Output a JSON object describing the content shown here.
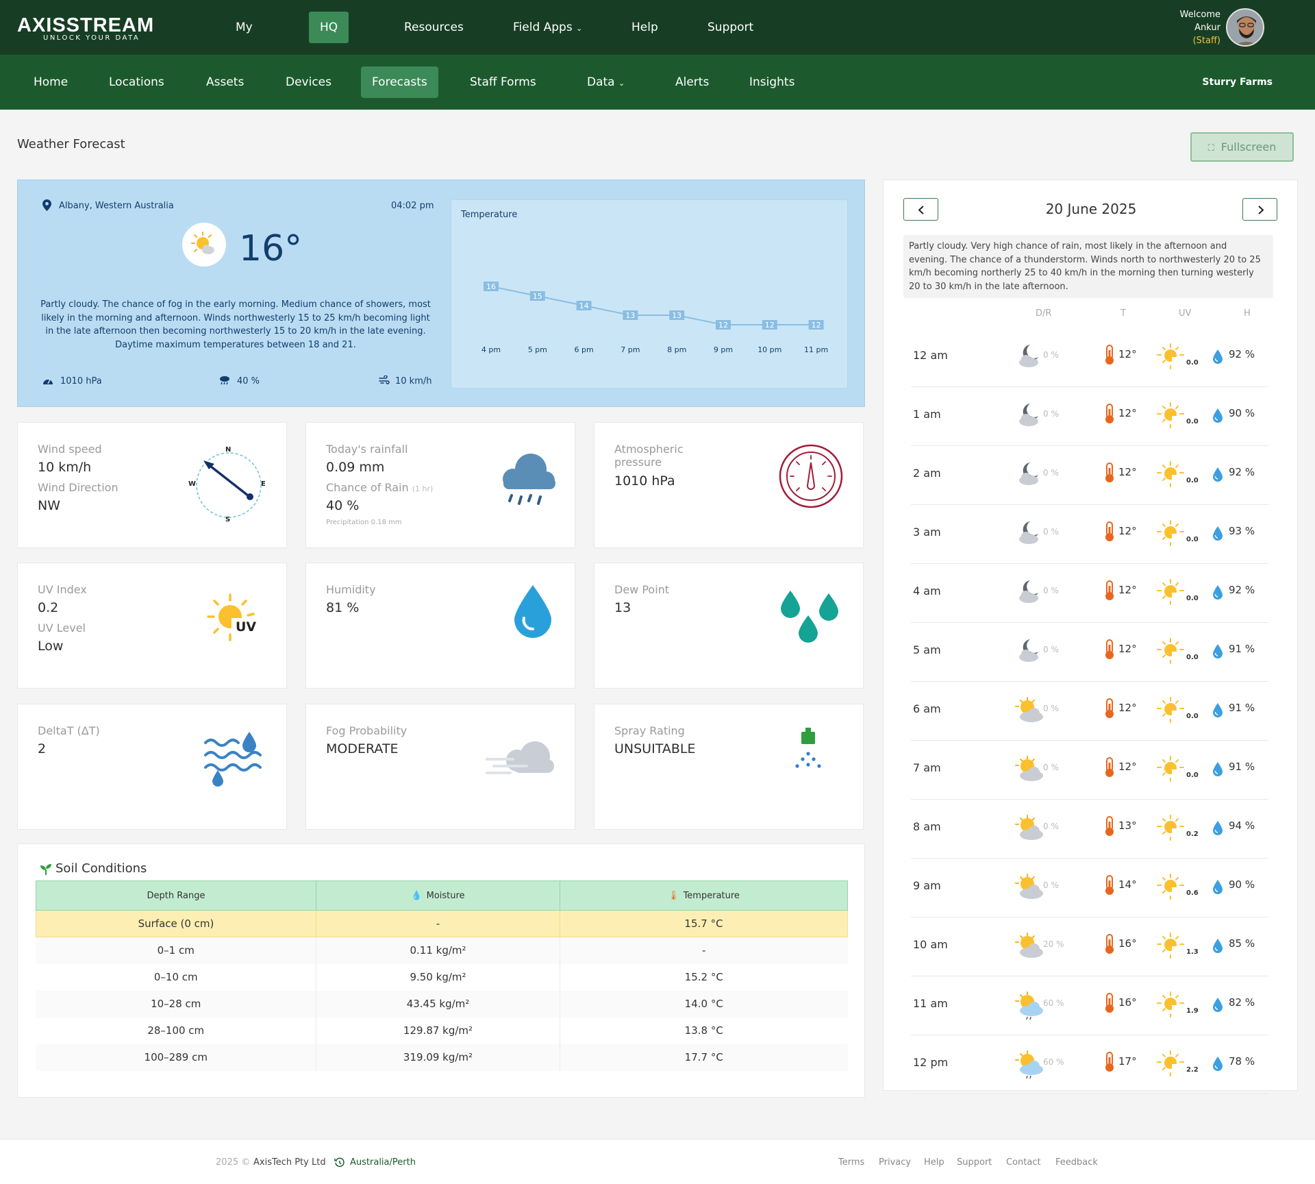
{
  "brand": {
    "name": "AXISSTREAM",
    "tagline": "UNLOCK YOUR DATA"
  },
  "top_nav": {
    "my": "My",
    "hq": "HQ",
    "resources": "Resources",
    "field_apps": "Field Apps",
    "help": "Help",
    "support": "Support"
  },
  "user": {
    "welcome": "Welcome",
    "name": "Ankur",
    "role": "(Staff)"
  },
  "sub_nav": {
    "home": "Home",
    "locations": "Locations",
    "assets": "Assets",
    "devices": "Devices",
    "forecasts": "Forecasts",
    "staff_forms": "Staff Forms",
    "data": "Data",
    "alerts": "Alerts",
    "insights": "Insights",
    "farm": "Sturry Farms"
  },
  "page": {
    "title": "Weather Forecast",
    "fullscreen_label": "Fullscreen"
  },
  "current": {
    "location": "Albany, Western Australia",
    "time": "04:02 pm",
    "temperature": "16°",
    "description": "Partly cloudy. The chance of fog in the early morning. Medium chance of showers, most likely in the morning and afternoon. Winds northwesterly 15 to 25 km/h becoming light in the late afternoon then becoming northwesterly 15 to 20 km/h in the late evening. Daytime maximum temperatures between 18 and 21.",
    "pressure": "1010 hPa",
    "rain_chance": "40 %",
    "wind": "10 km/h"
  },
  "chart_data": {
    "type": "line",
    "title": "Temperature",
    "categories": [
      "4 pm",
      "5 pm",
      "6 pm",
      "7 pm",
      "8 pm",
      "9 pm",
      "10 pm",
      "11 pm"
    ],
    "values": [
      16,
      15,
      14,
      13,
      13,
      12,
      12,
      12
    ],
    "ylim": [
      10,
      18
    ],
    "color": "#8bbde3"
  },
  "cards": {
    "wind": {
      "speed_label": "Wind speed",
      "speed": "10 km/h",
      "dir_label": "Wind Direction",
      "dir": "NW",
      "compass": [
        "N",
        "E",
        "S",
        "W"
      ]
    },
    "rain": {
      "label": "Today's rainfall",
      "value": "0.09 mm",
      "chance_label": "Chance of Rain",
      "chance_unit": "(1 hr)",
      "chance": "40 %",
      "precip": "Precipitation 0.18 mm"
    },
    "pressure": {
      "label": "Atmospheric pressure",
      "value": "1010 hPa"
    },
    "uv": {
      "index_label": "UV Index",
      "index": "0.2",
      "level_label": "UV Level",
      "level": "Low",
      "icon_text": "UV"
    },
    "humidity": {
      "label": "Humidity",
      "value": "81 %"
    },
    "dew": {
      "label": "Dew Point",
      "value": "13"
    },
    "delta": {
      "label": "DeltaT (ΔT)",
      "value": "2"
    },
    "fog": {
      "label": "Fog Probability",
      "value": "MODERATE"
    },
    "spray": {
      "label": "Spray Rating",
      "value": "UNSUITABLE"
    }
  },
  "soil": {
    "title": "Soil Conditions",
    "headers": [
      "Depth Range",
      "Moisture",
      "Temperature"
    ],
    "rows": [
      [
        "Surface (0 cm)",
        "-",
        "15.7 °C"
      ],
      [
        "0–1 cm",
        "0.11 kg/m²",
        "-"
      ],
      [
        "0–10 cm",
        "9.50 kg/m²",
        "15.2 °C"
      ],
      [
        "10–28 cm",
        "43.45 kg/m²",
        "14.0 °C"
      ],
      [
        "28–100 cm",
        "129.87 kg/m²",
        "13.8 °C"
      ],
      [
        "100–289 cm",
        "319.09 kg/m²",
        "17.7 °C"
      ]
    ]
  },
  "daily": {
    "date": "20 June 2025",
    "description": "Partly cloudy. Very high chance of rain, most likely in the afternoon and evening. The chance of a thunderstorm. Winds north to northwesterly 20 to 25 km/h becoming northerly 25 to 40 km/h in the morning then turning westerly 20 to 30 km/h in the late afternoon.",
    "columns": [
      "D/R",
      "T",
      "UV",
      "H"
    ],
    "hours": [
      {
        "time": "12 am",
        "icon": "moon-cloud-icon",
        "rain": "0 %",
        "temp": "12°",
        "uv": "0.0",
        "hum": "92 %"
      },
      {
        "time": "1 am",
        "icon": "moon-cloud-icon",
        "rain": "0 %",
        "temp": "12°",
        "uv": "0.0",
        "hum": "90 %"
      },
      {
        "time": "2 am",
        "icon": "moon-cloud-icon",
        "rain": "0 %",
        "temp": "12°",
        "uv": "0.0",
        "hum": "92 %"
      },
      {
        "time": "3 am",
        "icon": "moon-cloud-icon",
        "rain": "0 %",
        "temp": "12°",
        "uv": "0.0",
        "hum": "93 %"
      },
      {
        "time": "4 am",
        "icon": "moon-cloud-icon",
        "rain": "0 %",
        "temp": "12°",
        "uv": "0.0",
        "hum": "92 %"
      },
      {
        "time": "5 am",
        "icon": "moon-cloud-icon",
        "rain": "0 %",
        "temp": "12°",
        "uv": "0.0",
        "hum": "91 %"
      },
      {
        "time": "6 am",
        "icon": "sun-cloud-icon",
        "rain": "0 %",
        "temp": "12°",
        "uv": "0.0",
        "hum": "91 %"
      },
      {
        "time": "7 am",
        "icon": "sun-cloud-icon",
        "rain": "0 %",
        "temp": "12°",
        "uv": "0.0",
        "hum": "91 %"
      },
      {
        "time": "8 am",
        "icon": "sun-cloud-icon",
        "rain": "0 %",
        "temp": "13°",
        "uv": "0.2",
        "hum": "94 %"
      },
      {
        "time": "9 am",
        "icon": "sun-cloud-icon",
        "rain": "0 %",
        "temp": "14°",
        "uv": "0.6",
        "hum": "90 %"
      },
      {
        "time": "10 am",
        "icon": "sun-cloud-icon",
        "rain": "20 %",
        "temp": "16°",
        "uv": "1.3",
        "hum": "85 %"
      },
      {
        "time": "11 am",
        "icon": "sun-cloud-rain-icon",
        "rain": "60 %",
        "temp": "16°",
        "uv": "1.9",
        "hum": "82 %"
      },
      {
        "time": "12 pm",
        "icon": "sun-cloud-rain-icon",
        "rain": "60 %",
        "temp": "17°",
        "uv": "2.2",
        "hum": "78 %"
      }
    ]
  },
  "footer": {
    "year": "2025 ©",
    "company": "AxisTech Pty Ltd",
    "timezone": "Australia/Perth",
    "links": [
      "Terms",
      "Privacy",
      "Help",
      "Support",
      "Contact",
      "Feedback"
    ]
  }
}
